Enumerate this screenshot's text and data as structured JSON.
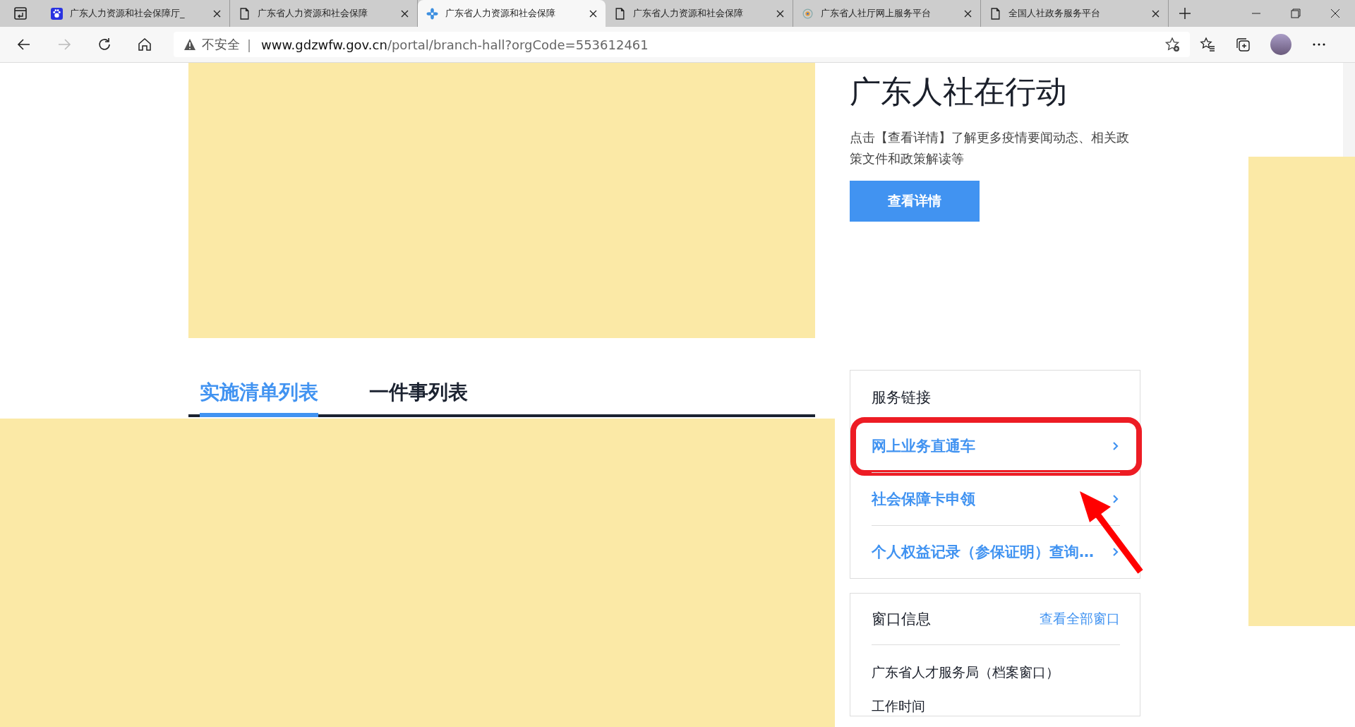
{
  "browser": {
    "tabs": [
      {
        "title": "广东人力资源和社会保障厅_",
        "selected": false
      },
      {
        "title": "广东省人力资源和社会保障",
        "selected": false
      },
      {
        "title": "广东省人力资源和社会保障",
        "selected": true
      },
      {
        "title": "广东省人力资源和社会保障",
        "selected": false
      },
      {
        "title": "广东省人社厅网上服务平台",
        "selected": false
      },
      {
        "title": "全国人社政务服务平台",
        "selected": false
      }
    ],
    "security": "不安全",
    "separator": "|",
    "url_host": "www.gdzwfw.gov.cn",
    "url_path": "/portal/branch-hall?orgCode=553612461"
  },
  "promo": {
    "title": "广东人社在行动",
    "description": "点击【查看详情】了解更多疫情要闻动态、相关政策文件和政策解读等",
    "button": "查看详情"
  },
  "list_tabs": [
    {
      "label": "实施清单列表",
      "selected": true
    },
    {
      "label": "一件事列表",
      "selected": false
    }
  ],
  "service_links": {
    "title": "服务链接",
    "items": [
      {
        "label": "网上业务直通车",
        "highlighted": true
      },
      {
        "label": "社会保障卡申领",
        "highlighted": false
      },
      {
        "label": "个人权益记录（参保证明）查询…",
        "highlighted": false
      }
    ]
  },
  "window_info": {
    "title": "窗口信息",
    "link": "查看全部窗口",
    "office": "广东省人才服务局（档案窗口）",
    "hours_label": "工作时间"
  }
}
